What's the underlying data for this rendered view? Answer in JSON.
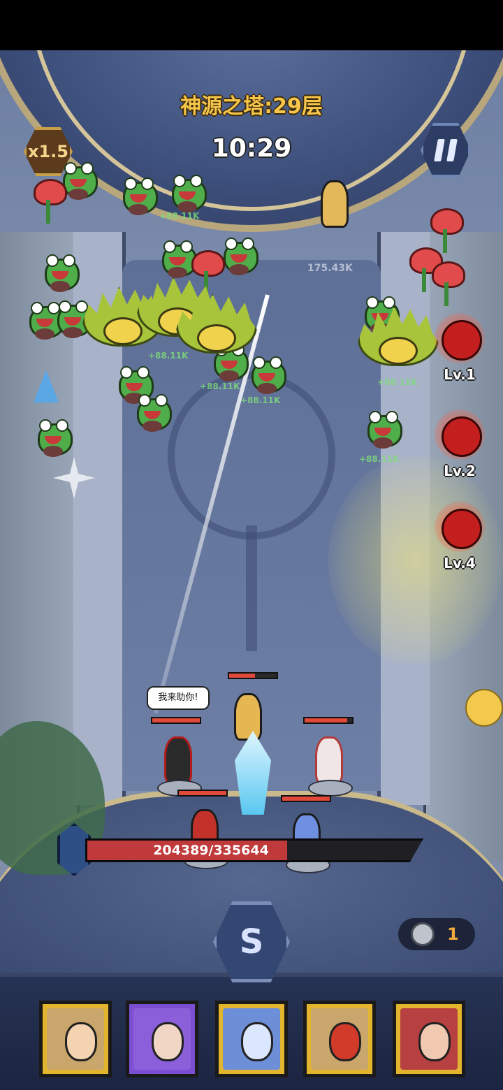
{
  "hud": {
    "floor_title": "神源之塔:29层",
    "timer": "10:29",
    "speed_multiplier": "x1.5",
    "pause_icon": "pause-icon"
  },
  "waves": [
    {
      "label": "Lv.1",
      "icon": "demon-wave-icon"
    },
    {
      "label": "Lv.2",
      "icon": "demon-wave-icon"
    },
    {
      "label": "Lv.4",
      "icon": "demon-wave-icon"
    }
  ],
  "battle": {
    "speech_bubble": "我来助你!",
    "damage_numbers": [
      "+88.11K",
      "+88.11K",
      "+88.11K",
      "+88.11K",
      "+88.11K",
      "+88.11K",
      "175.43K"
    ]
  },
  "base": {
    "hp_text": "204389/335644",
    "hp_current": 204389,
    "hp_max": 335644
  },
  "skill": {
    "icon": "swirl-skill-icon",
    "glyph": "S"
  },
  "currency": {
    "icon": "silver-coin-icon",
    "count": "1"
  },
  "hero_cards": [
    {
      "name": "golden-goddess",
      "frame_color": "#e3b52f",
      "bg": "#c9a66b",
      "face": "#f4d3b0"
    },
    {
      "name": "white-haired-priestess",
      "frame_color": "#7b4fd1",
      "bg": "#8b5fd9",
      "face": "#f1d6c6"
    },
    {
      "name": "ice-dragon",
      "frame_color": "#e3b52f",
      "bg": "#6d8fd8",
      "face": "#dbe6ff"
    },
    {
      "name": "red-bomb-robot",
      "frame_color": "#e3b52f",
      "bg": "#c9a66b",
      "face": "#d23a2a"
    },
    {
      "name": "masked-ninja",
      "frame_color": "#e3b52f",
      "bg": "#b74040",
      "face": "#f0c9b0"
    }
  ],
  "colors": {
    "accent_gold": "#f6c64c",
    "hp_red": "#c0393b",
    "enemy_green": "#4fae4a"
  }
}
